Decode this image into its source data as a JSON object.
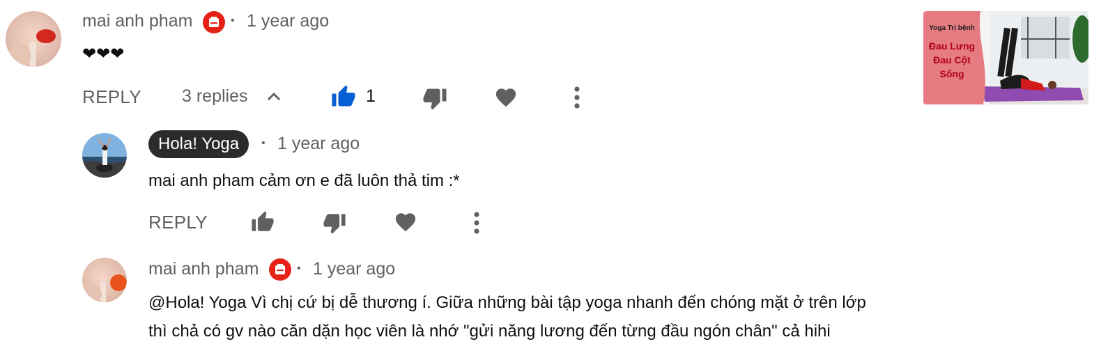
{
  "comment": {
    "author": "mai anh pham",
    "time": "1 year ago",
    "text": "❤❤❤",
    "reply_label": "REPLY",
    "replies_label": "3 replies",
    "like_count": "1"
  },
  "replies": [
    {
      "author": "Hola! Yoga",
      "time": "1 year ago",
      "text": "mai anh pham cảm ơn e đã luôn thả tim :*",
      "reply_label": "REPLY"
    },
    {
      "author": "mai anh pham",
      "time": "1 year ago",
      "text_line1": "@Hola! Yoga Vì chị cứ bị dễ thương í. Giữa những bài tập yoga nhanh đến chóng mặt ở trên lớp",
      "text_line2": "thì chả có gv nào căn dặn học viên là nhớ \"gửi năng lương đến từng đầu ngón chân\" cả hihi"
    }
  ],
  "thumbnail": {
    "small_title": "Yoga Trị bệnh",
    "line1": "Đau Lưng",
    "line2": "Đau Cột",
    "line3": "Sống"
  },
  "colors": {
    "like_active": "#065fd4",
    "icon_gray": "#606060",
    "badge_red": "#e62117",
    "thumb_pink": "#e77b82"
  }
}
